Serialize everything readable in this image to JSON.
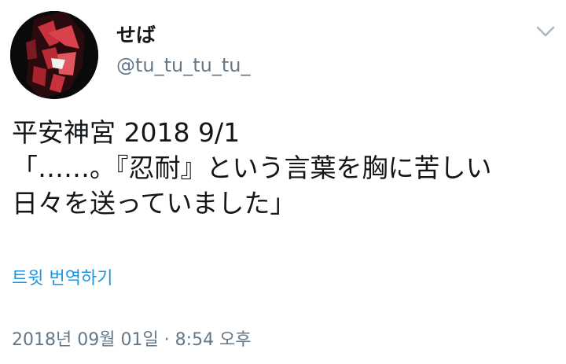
{
  "author": {
    "display_name": "せば",
    "username": "@tu_tu_tu_tu_"
  },
  "tweet": {
    "text": "平安神宮 2018 9/1\n「……。『忍耐』という言葉を胸に苦しい\n日々を送っていました」",
    "translate_label": "트윗 번역하기",
    "timestamp": "2018년 09월 01일 · 8:54 오후"
  },
  "icons": {
    "menu": "chevron-down-icon"
  },
  "colors": {
    "link": "#1b95e0",
    "secondary_text": "#657786",
    "primary_text": "#14171a",
    "caret": "#aab8c2"
  }
}
